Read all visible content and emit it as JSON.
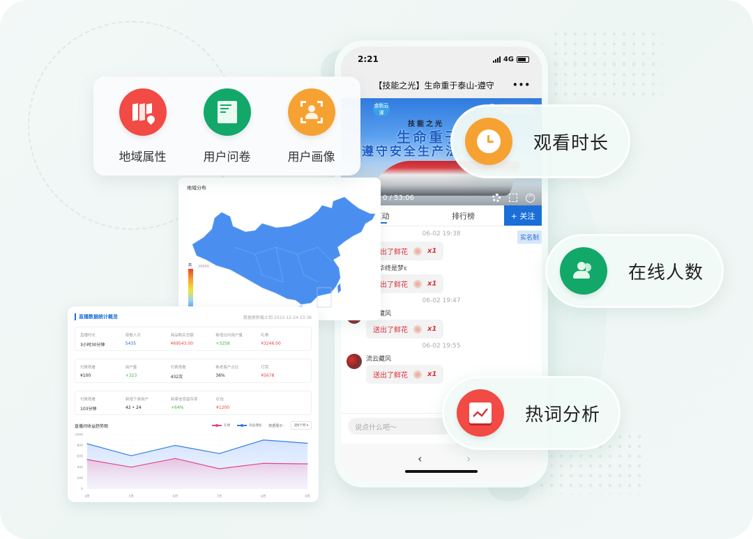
{
  "feature_card": {
    "items": [
      {
        "label": "地域属性",
        "icon": "map-pin-icon",
        "color": "#f24a44"
      },
      {
        "label": "用户问卷",
        "icon": "document-icon",
        "color": "#12a86a"
      },
      {
        "label": "用户画像",
        "icon": "face-scan-icon",
        "color": "#f6a233"
      }
    ]
  },
  "pills": [
    {
      "label": "观看时长",
      "icon": "clock-icon",
      "color": "#f6a233"
    },
    {
      "label": "在线人数",
      "icon": "users-icon",
      "color": "#12a86a"
    },
    {
      "label": "热词分析",
      "icon": "trend-chart-icon",
      "color": "#f24a44"
    }
  ],
  "phone": {
    "status": {
      "time": "2:21",
      "network": "4G"
    },
    "nav": {
      "back": "✕",
      "title": "【技能之光】生命重于泰山-遵守",
      "more": "•••"
    },
    "video": {
      "logo": "金轨云课",
      "views": "🔥 2238",
      "title_small": "技能之光",
      "title_line1": "生命重于泰山",
      "title_line2": "遵守安全生产法",
      "time": "0 / 53:06"
    },
    "tabs": [
      {
        "label": "互动",
        "active": true
      },
      {
        "label": "排行榜",
        "active": false
      }
    ],
    "follow": "+ 关注",
    "realname": "实名制",
    "chat": [
      {
        "type": "time",
        "text": "06-02 19:38"
      },
      {
        "type": "gift",
        "nick": "",
        "gift": "送出了鲜花",
        "count": "x1"
      },
      {
        "type": "gift",
        "nick": "流年华终是梦ε",
        "gift": "送出了鲜花",
        "count": "x1"
      },
      {
        "type": "time",
        "text": "06-02 19:47"
      },
      {
        "type": "gift",
        "nick": "流云藏风",
        "gift": "送出了鲜花",
        "count": "x1"
      },
      {
        "type": "time",
        "text": "06-02 19:55"
      },
      {
        "type": "gift",
        "nick": "流云藏风",
        "gift": "送出了鲜花",
        "count": "x1"
      }
    ],
    "input_placeholder": "说点什么吧～",
    "back_glyph": "‹",
    "forward_glyph": "›"
  },
  "map_card": {
    "title": "地域分布",
    "legend_high": "高",
    "legend_max": "20000"
  },
  "stats_card": {
    "title": "直播数据统计概览",
    "updated": "数据更新截止到 2022-12-24 23:36",
    "groups": [
      [
        {
          "label": "直播时长",
          "value": "3小时30分钟",
          "color": "#222"
        },
        {
          "label": "观看人次",
          "value": "5435",
          "color": "#1a6ed8"
        },
        {
          "label": "商品购买总额",
          "value": "¥69543.00",
          "color": "#f23c3c"
        },
        {
          "label": "新增访问用户量",
          "value": "+3258",
          "color": "#2fb84a"
        },
        {
          "label": "礼物",
          "value": "¥3246.00",
          "color": "#f23c3c"
        }
      ],
      [
        {
          "label": "付费观看",
          "value": "¥100",
          "color": "#222"
        },
        {
          "label": "用户量",
          "value": "+323",
          "color": "#2fb84a"
        },
        {
          "label": "付费观看",
          "value": "432次",
          "color": "#222"
        },
        {
          "label": "新老客户占比",
          "value": "36%",
          "color": "#222"
        },
        {
          "label": "打赏",
          "value": "¥5678",
          "color": "#f23c3c"
        }
      ],
      [
        {
          "label": "付费观看",
          "value": "103分钟",
          "color": "#222"
        },
        {
          "label": "新增下单用户",
          "value": "42 • 24",
          "color": "#222"
        },
        {
          "label": "新客信息留存率",
          "value": "+64%",
          "color": "#2fb84a"
        },
        {
          "label": "红包",
          "value": "¥1200",
          "color": "#f23c3c"
        }
      ]
    ],
    "trend": {
      "title": "直播间收益趋势图",
      "legend": [
        {
          "name": "礼物",
          "color": "#e0458b"
        },
        {
          "name": "商品增加",
          "color": "#2f7be6"
        }
      ],
      "range_label": "数据展示:",
      "range_value": "近6个月 ▾"
    }
  },
  "chart_data": {
    "type": "area",
    "title": "直播间收益趋势图",
    "categories": [
      "4月",
      "5月",
      "6月",
      "7月",
      "8月",
      "9月"
    ],
    "series": [
      {
        "name": "商品增加",
        "values": [
          830,
          610,
          800,
          650,
          900,
          840
        ],
        "color": "#2f7be6"
      },
      {
        "name": "礼物",
        "values": [
          540,
          400,
          560,
          370,
          470,
          460
        ],
        "color": "#e0458b"
      }
    ],
    "yticks": [
      0,
      200,
      400,
      600,
      800,
      1000
    ],
    "ylim": [
      0,
      1000
    ],
    "legend": "top-right",
    "grid": true
  }
}
